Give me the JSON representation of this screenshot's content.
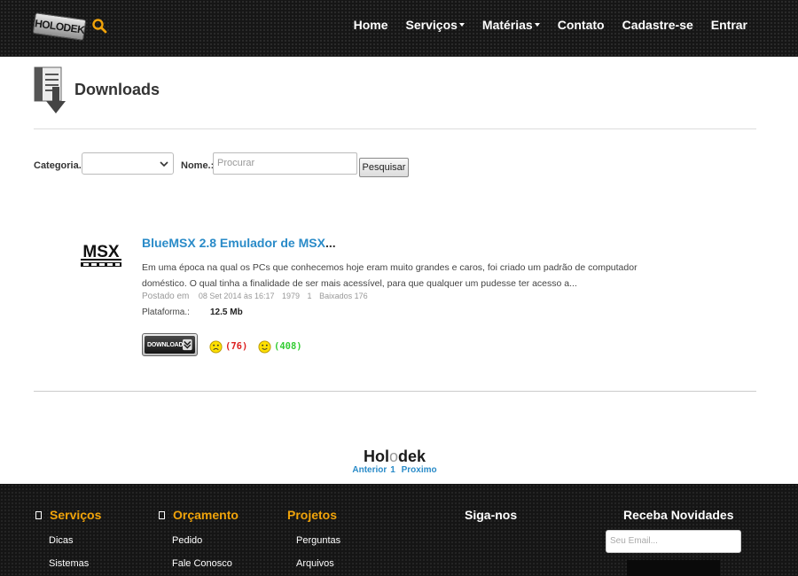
{
  "nav": {
    "logo_text": "HOLODEK",
    "links": [
      "Home",
      "Serviços",
      "Matérias",
      "Contato",
      "Cadastre-se",
      "Entrar"
    ],
    "search_icon": "search-icon",
    "accent_color": "#f0a30a"
  },
  "page": {
    "title": "Downloads"
  },
  "filter": {
    "category_label": "Categoria.:",
    "category_value": "",
    "name_label": "Nome.:",
    "name_placeholder": "Procurar",
    "search_button": "Pesquisar"
  },
  "item": {
    "thumb_text": "MSX",
    "title": "BlueMSX 2.8 Emulador de MSX",
    "title_ellipsis": "...",
    "description": "Em uma época na qual os PCs que conhecemos hoje eram muito grandes e caros, foi criado um padrão de computador doméstico. O qual tinha a finalidade de ser mais acessível, para que qualquer um pudesse ter acesso a...",
    "posted_label": "Postado em",
    "posted_date": "08 Set 2014 às 16:17",
    "year": "1979",
    "count": "1",
    "downloads": "Baixados 176",
    "platform_label": "Plataforma.:",
    "size": "12.5 Mb",
    "download_button": "DOWNLOAD",
    "votes_down": "(76)",
    "votes_up": "(408)"
  },
  "brand": {
    "part1": "Hol",
    "part2": "o",
    "part3": "dek"
  },
  "pager": {
    "prev": "Anterior",
    "page": "1",
    "next": "Proximo"
  },
  "footer": {
    "col1": {
      "title": "Serviços",
      "links": [
        "Dicas",
        "Sistemas"
      ]
    },
    "col2": {
      "title": "Orçamento",
      "links": [
        "Pedido",
        "Fale Conosco"
      ]
    },
    "col3": {
      "title": "Projetos",
      "links": [
        "Perguntas",
        "Arquivos"
      ]
    },
    "col4": {
      "title": "Siga-nos"
    },
    "col5": {
      "title": "Receba Novidades",
      "email_placeholder": "Seu Email..."
    }
  }
}
